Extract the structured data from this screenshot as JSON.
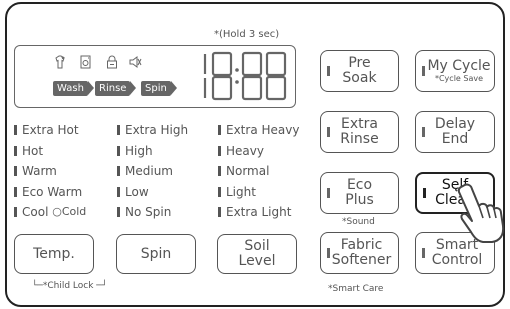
{
  "hold_note": "*(Hold 3 sec)",
  "display": {
    "icons": [
      "shirt-star-icon",
      "door-icon",
      "lock-icon",
      "mute-icon"
    ],
    "stages": [
      "Wash",
      "Rinse",
      "Spin"
    ],
    "time": "18:88"
  },
  "temp_options": [
    "Extra Hot",
    "Hot",
    "Warm",
    "Eco Warm",
    "Cool"
  ],
  "temp_cold": "○Cold",
  "spin_options": [
    "Extra High",
    "High",
    "Medium",
    "Low",
    "No Spin"
  ],
  "soil_options": [
    "Extra Heavy",
    "Heavy",
    "Normal",
    "Light",
    "Extra Light"
  ],
  "buttons": {
    "temp": "Temp.",
    "spin": "Spin",
    "soil_level_1": "Soil",
    "soil_level_2": "Level",
    "pre_soak_1": "Pre",
    "pre_soak_2": "Soak",
    "my_cycle": "My Cycle",
    "my_cycle_sub": "*Cycle Save",
    "extra_rinse_1": "Extra",
    "extra_rinse_2": "Rinse",
    "delay_end_1": "Delay",
    "delay_end_2": "End",
    "eco_plus_1": "Eco",
    "eco_plus_2": "Plus",
    "self_clean_1": "Self",
    "self_clean_2": "Clean",
    "fabric_softener_1": "Fabric",
    "fabric_softener_2": "Softener",
    "smart_control_1": "Smart",
    "smart_control_2": "Control"
  },
  "notes": {
    "sound": "*Sound",
    "smart_care": "*Smart Care",
    "child_lock": "*Child Lock"
  }
}
